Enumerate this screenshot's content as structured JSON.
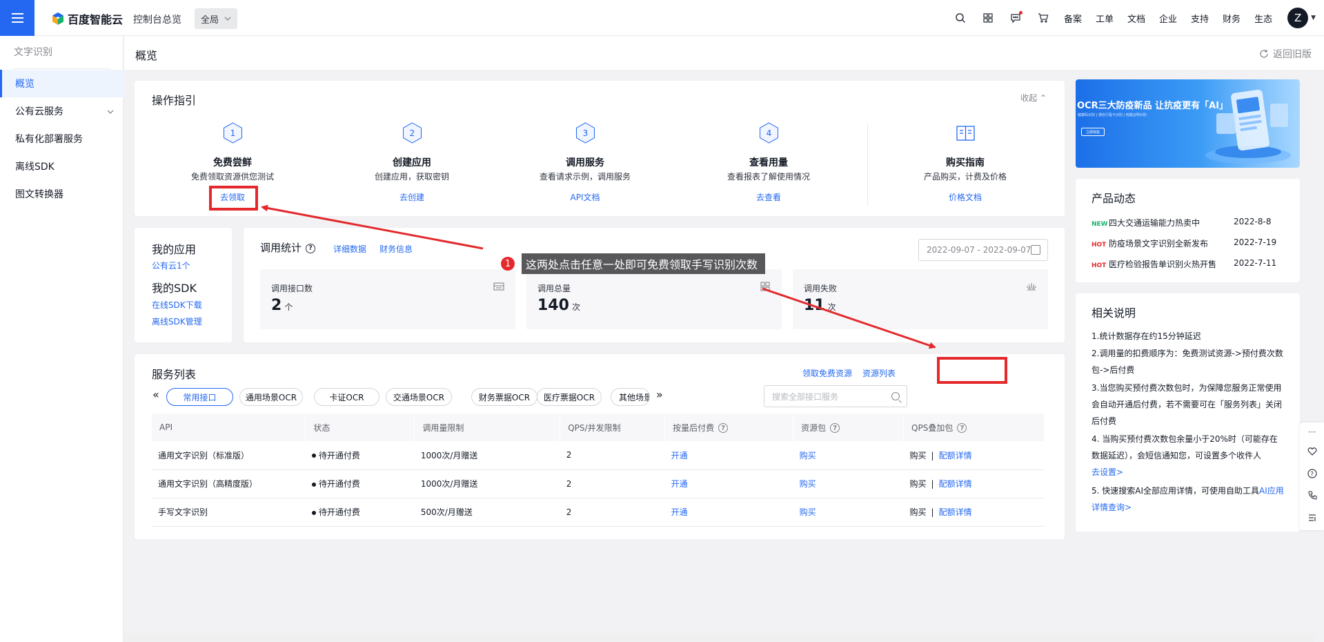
{
  "topbar": {
    "brand": "百度智能云",
    "console": "控制台总览",
    "region": "全局",
    "nav_links": [
      "备案",
      "工单",
      "文档",
      "企业",
      "支持",
      "财务",
      "生态"
    ],
    "avatar_letter": "Z"
  },
  "sidebar": {
    "title": "文字识别",
    "items": [
      {
        "label": "概览",
        "active": true
      },
      {
        "label": "公有云服务",
        "has_children": true
      },
      {
        "label": "私有化部署服务"
      },
      {
        "label": "离线SDK"
      },
      {
        "label": "图文转换器"
      }
    ]
  },
  "header": {
    "title": "概览",
    "back_label": "返回旧版"
  },
  "guide": {
    "title": "操作指引",
    "collapse_label": "收起",
    "steps": [
      {
        "num": "1",
        "title": "免费尝鲜",
        "desc": "免费领取资源供您测试",
        "link": "去领取"
      },
      {
        "num": "2",
        "title": "创建应用",
        "desc": "创建应用，获取密钥",
        "link": "去创建"
      },
      {
        "num": "3",
        "title": "调用服务",
        "desc": "查看请求示例，调用服务",
        "link": "API文档"
      },
      {
        "num": "4",
        "title": "查看用量",
        "desc": "查看报表了解使用情况",
        "link": "去查看"
      }
    ],
    "buy": {
      "title": "购买指南",
      "desc": "产品购买，计费及价格",
      "link": "价格文档"
    }
  },
  "my_apps": {
    "apps_title": "我的应用",
    "apps_link": "公有云1个",
    "sdk_title": "我的SDK",
    "sdk_links": [
      "在线SDK下载",
      "离线SDK管理"
    ]
  },
  "stats": {
    "title": "调用统计",
    "detail_link": "详细数据",
    "finance_link": "财务信息",
    "date_range": "2022-09-07 - 2022-09-07",
    "metrics": [
      {
        "label": "调用接口数",
        "value": "2",
        "unit": "个"
      },
      {
        "label": "调用总量",
        "value": "140",
        "unit": "次"
      },
      {
        "label": "调用失败",
        "value": "11",
        "unit": "次"
      }
    ]
  },
  "services": {
    "title": "服务列表",
    "free_resource_link": "领取免费资源",
    "resource_list_link": "资源列表",
    "tags": [
      "常用接口",
      "通用场景OCR",
      "卡证OCR",
      "交通场景OCR",
      "财务票据OCR",
      "医疗票据OCR",
      "其他场景"
    ],
    "search_placeholder": "搜索全部接口服务",
    "columns": [
      "API",
      "状态",
      "调用量限制",
      "QPS/并发限制",
      "按量后付费",
      "资源包",
      "QPS叠加包"
    ],
    "rows": [
      {
        "api": "通用文字识别（标准版）",
        "status": "待开通付费",
        "limit": "1000次/月赠送",
        "qps": "2",
        "postpaid": "开通",
        "pack": "购买",
        "qps_buy": "购买",
        "qps_detail": "配额详情"
      },
      {
        "api": "通用文字识别（高精度版）",
        "status": "待开通付费",
        "limit": "1000次/月赠送",
        "qps": "2",
        "postpaid": "开通",
        "pack": "购买",
        "qps_buy": "购买",
        "qps_detail": "配额详情"
      },
      {
        "api": "手写文字识别",
        "status": "待开通付费",
        "limit": "500次/月赠送",
        "qps": "2",
        "postpaid": "开通",
        "pack": "购买",
        "qps_buy": "购买",
        "qps_detail": "配额详情"
      }
    ]
  },
  "banner": {
    "title": "OCR三大防疫新品 让抗疫更有「AI」",
    "subtitle": "健康码识别 | 通信行程卡识别 | 核酸证明识别",
    "button": "立即体验"
  },
  "news": {
    "title": "产品动态",
    "items": [
      {
        "tag": "NEW",
        "text": "四大交通运输能力热卖中",
        "date": "2022-8-8",
        "tag_color": "#17b26a"
      },
      {
        "tag": "HOT",
        "text": "防疫场景文字识别全新发布",
        "date": "2022-7-19",
        "tag_color": "#e3292c"
      },
      {
        "tag": "HOT",
        "text": "医疗检验报告单识别火热开售",
        "date": "2022-7-11",
        "tag_color": "#e3292c"
      }
    ]
  },
  "notes": {
    "title": "相关说明",
    "items": [
      "1.统计数据存在约15分钟延迟",
      "2.调用量的扣费顺序为：免费测试资源->预付费次数包->后付费",
      "3.当您购买预付费次数包时，为保障您服务正常使用会自动开通后付费，若不需要可在「服务列表」关闭后付费",
      "4. 当购买预付费次数包余量小于20%时（可能存在数据延迟），会短信通知您，可设置多个收件人"
    ],
    "item4_link": "去设置>",
    "item5_prefix": "5. 快速搜索AI全部应用详情，可使用自助工具",
    "item5_link": "AI应用详情查询>"
  },
  "annotation": {
    "badge": "1",
    "text": "这两处点击任意一处即可免费领取手写识别次数"
  },
  "colors": {
    "accent": "#2468f2",
    "annotation_red": "#e3292c"
  }
}
